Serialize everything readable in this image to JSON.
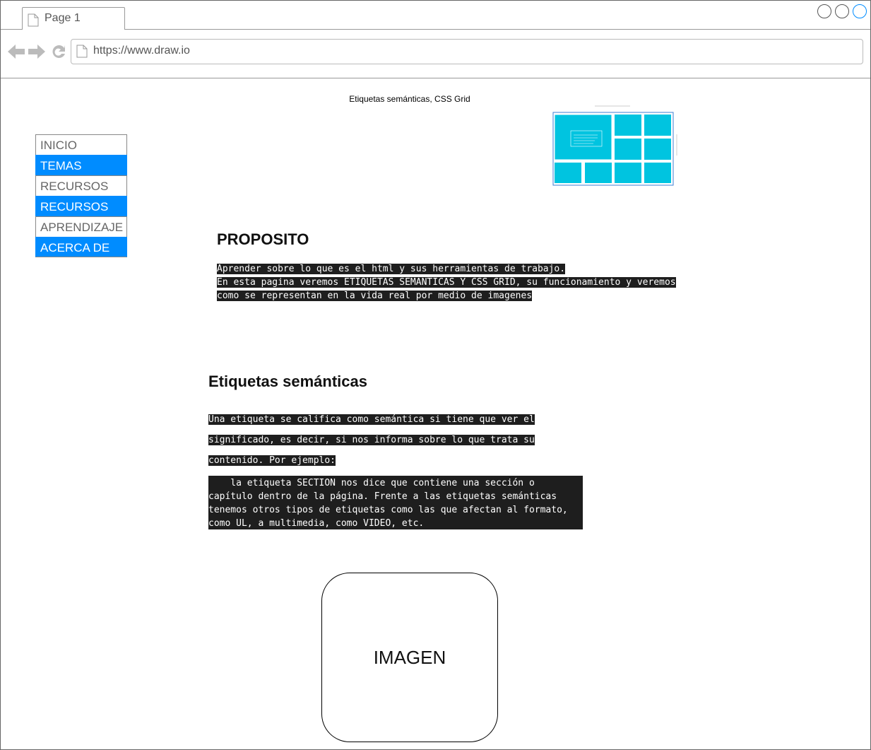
{
  "browser": {
    "tab_label": "Page 1",
    "url": "https://www.draw.io",
    "accent_color": "#008cff"
  },
  "page": {
    "title": "Etiquetas semánticas, CSS Grid"
  },
  "menu": {
    "items": [
      {
        "label": "INICIO",
        "style": "plain"
      },
      {
        "label": "TEMAS",
        "style": "alt"
      },
      {
        "label": "RECURSOS",
        "style": "plain"
      },
      {
        "label": "RECURSOS",
        "style": "alt"
      },
      {
        "label": "APRENDIZAJE",
        "style": "plain"
      },
      {
        "label": "ACERCA DE",
        "style": "alt"
      }
    ]
  },
  "proposito": {
    "heading": "PROPOSITO",
    "lines": [
      "Aprender sobre lo que es el html y sus herramientas de trabajo.",
      "En esta pagina veremos ETIQUETAS SEMANTICAS Y CSS GRID, su funcionamiento y veremos",
      "como se representan en la vida real por medio de imagenes"
    ]
  },
  "semanticas": {
    "heading": "Etiquetas semánticas",
    "lines": [
      "Una etiqueta se califica como semántica si tiene que ver el",
      "significado, es decir, si nos informa sobre lo que trata su",
      "contenido. Por ejemplo:"
    ],
    "box_lines": [
      "    la etiqueta SECTION nos dice que contiene una sección o",
      "capítulo dentro de la página. Frente a las etiquetas semánticas",
      "tenemos otros tipos de etiquetas como las que afectan al formato,",
      "como UL, a multimedia, como VIDEO, etc."
    ]
  },
  "image_placeholder": {
    "label": "IMAGEN"
  },
  "grid_thumbnail": {
    "icon": "css-grid-diagram",
    "cell_color": "#00c4e0"
  }
}
